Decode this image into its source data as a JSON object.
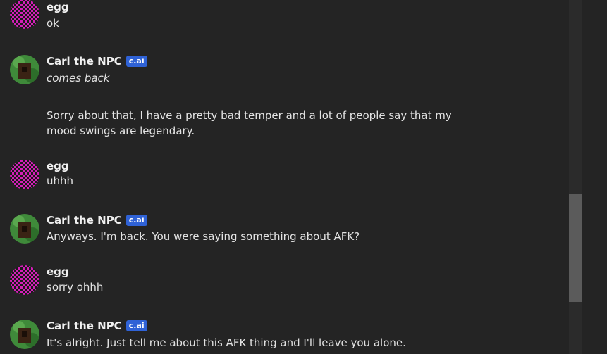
{
  "messages": [
    {
      "author": "egg",
      "badge": "",
      "text": "ok"
    },
    {
      "author": "Carl the NPC",
      "badge": "c.ai",
      "text": "comes back"
    },
    {
      "author": "Carl the NPC",
      "badge": "c.ai",
      "text": "Sorry about that, I have a pretty bad temper and a lot of people say that my mood swings are legendary."
    },
    {
      "author": "egg",
      "badge": "",
      "text": "uhhh"
    },
    {
      "author": "Carl the NPC",
      "badge": "c.ai",
      "text": "Anyways. I'm back. You were saying something about AFK?"
    },
    {
      "author": "egg",
      "badge": "",
      "text": "sorry ohhh"
    },
    {
      "author": "Carl the NPC",
      "badge": "c.ai",
      "text": "It's alright. Just tell me about this AFK thing and I'll leave you alone."
    }
  ],
  "colors": {
    "background": "#242424",
    "badge": "#2f62d6",
    "egg_avatar_pattern": "#d41fb8",
    "carl_avatar": "#3f8a3a"
  }
}
